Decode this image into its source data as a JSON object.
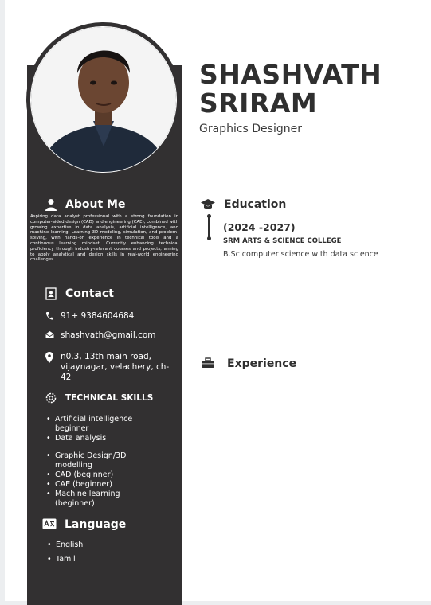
{
  "name_line1": "SHASHVATH",
  "name_line2": "SRIRAM",
  "role": "Graphics Designer",
  "about": {
    "title": "About Me",
    "text": "Aspiring data analyst professional with a strong foundation in computer-aided design (CAD) and engineering (CAE), combined with growing expertise in data analysis, artificial intelligence, and machine learning. Learning 3D modeling, simulation, and problem-solving, with hands-on experience in technical tools and a continuous learning mindset. Currently enhancing technical proficiency through industry-relevant courses and projects, aiming to apply analytical and design skills in real-world engineering challenges."
  },
  "contact": {
    "title": "Contact",
    "phone": "91+ 9384604684",
    "email": "shashvath@gmail.com",
    "address": "n0.3, 13th main road, vijaynagar, velachery, ch-42"
  },
  "skills": {
    "title": "TECHNICAL SKILLS",
    "items": [
      "Artificial intelligence beginner",
      "Data analysis",
      "Graphic Design/3D modelling",
      "CAD (beginner)",
      "CAE (beginner)",
      "Machine learning (beginner)"
    ]
  },
  "language": {
    "title": "Language",
    "items": [
      "English",
      "Tamil"
    ]
  },
  "education": {
    "title": "Education",
    "years": "(2024 -2027)",
    "college": "SRM ARTS & SCIENCE COLLEGE",
    "degree": "B.Sc computer science with data science"
  },
  "experience": {
    "title": "Experience"
  },
  "colors": {
    "sidebar": "#323031",
    "text_dark": "#2f2f2f",
    "text_light": "#ffffff"
  }
}
